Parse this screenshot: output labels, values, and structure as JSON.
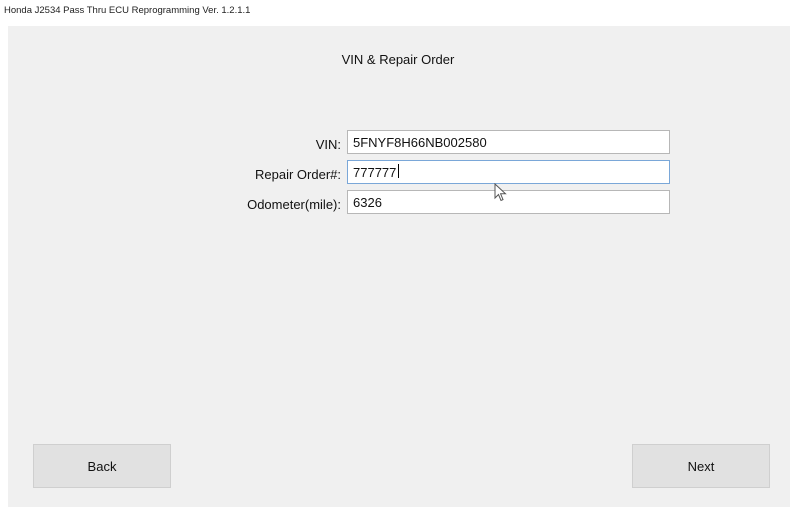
{
  "window": {
    "title": "Honda J2534 Pass Thru ECU Reprogramming Ver. 1.2.1.1"
  },
  "page": {
    "heading": "VIN & Repair Order"
  },
  "form": {
    "vin": {
      "label": "VIN:",
      "value": "5FNYF8H66NB002580"
    },
    "repair_order": {
      "label": "Repair Order#:",
      "value": "777777"
    },
    "odometer": {
      "label": "Odometer(mile):",
      "value": "6326"
    }
  },
  "buttons": {
    "back_label": "Back",
    "next_label": "Next"
  },
  "icons": {
    "cursor": "mouse-pointer-icon"
  },
  "colors": {
    "panel_bg": "#f0f0f0",
    "focus_border": "#7aa7d8",
    "button_bg": "#e1e1e1"
  }
}
